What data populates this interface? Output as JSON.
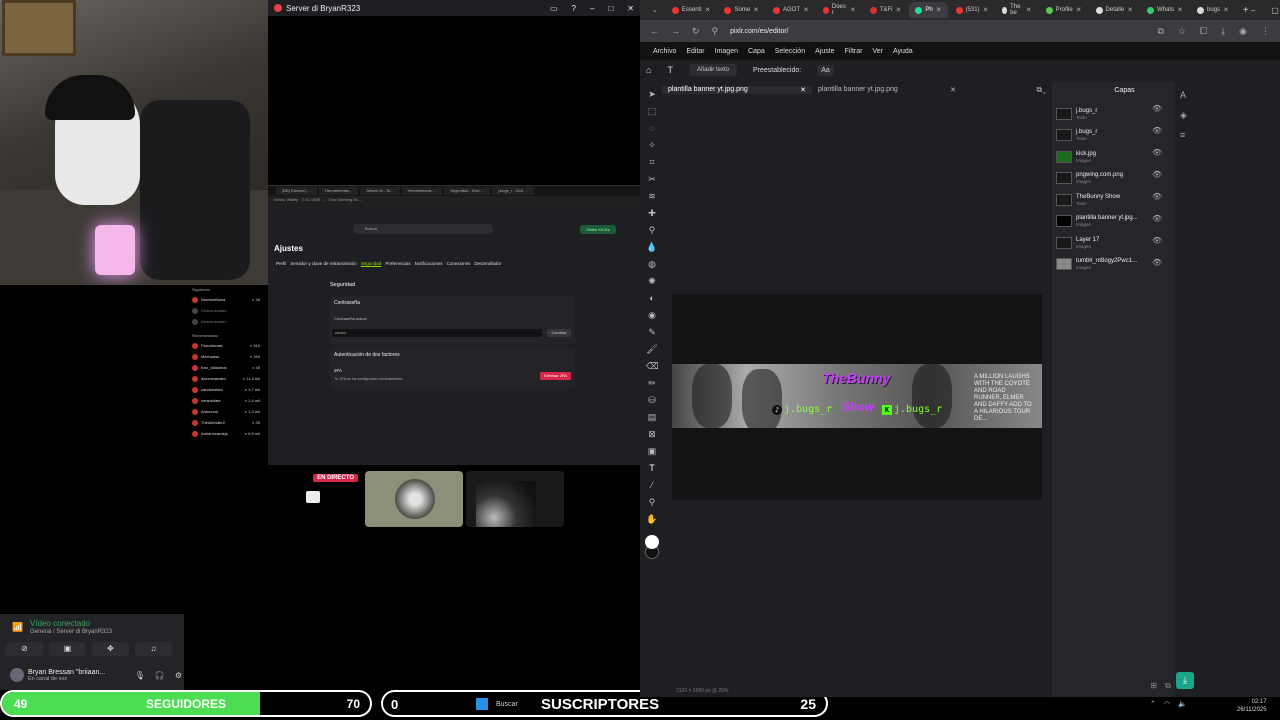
{
  "discord": {
    "window_title": "Server di BryanR323",
    "shared_screen": {
      "tabs": [
        "[DB] Discord | ...",
        "Herramientas...",
        "Añadir IA - Te...",
        "Herramientas ...",
        "Seguridad - Kick ...",
        "j.bugs_r - Kick ..."
      ],
      "bookmarks": "Kiroku Vitality · 7 XL GWE ... · Ono VabVerg 66 ...",
      "search_placeholder": "Buscar",
      "obtain_label": "Obtén KICKs",
      "heading": "Ajustes",
      "settings_tabs": [
        "Perfil",
        "Servidor y clave de retransmisión",
        "Seguridad",
        "Preferencias",
        "Notificaciones",
        "Conexiones",
        "Desarrollador"
      ],
      "active_tab": "Seguridad",
      "section_title": "Seguridad",
      "password_title": "Contraseña",
      "password_label": "Contraseña actual",
      "password_value": "••••••••",
      "change_label": "Cambiar",
      "twofa_title": "Autenticación de dos factores",
      "twofa_label": "2FA",
      "twofa_desc": "Tu 2FA se ha configurado correctamente",
      "delete_2fa_label": "Eliminar 2FA"
    },
    "following": {
      "heading": "Siguiendo",
      "items": [
        {
          "name": "NombreBuiza",
          "count": "36"
        },
        {
          "name": "Desconectado",
          "count": ""
        },
        {
          "name": "Desconectado",
          "count": ""
        }
      ]
    },
    "recommended": {
      "heading": "Recomendado",
      "items": [
        {
          "name": "PanoAnnasi",
          "count": "515"
        },
        {
          "name": "Mechaass",
          "count": "254"
        },
        {
          "name": "fran_villalobos",
          "count": "48"
        },
        {
          "name": "daxxninanalm",
          "count": "11,3 mil"
        },
        {
          "name": "zandoeskira",
          "count": "3,7 mil"
        },
        {
          "name": "cmaninfate",
          "count": "1,4 mil"
        },
        {
          "name": "Antuunus",
          "count": "1,3 mil"
        },
        {
          "name": "TheAllenderZ",
          "count": "35"
        },
        {
          "name": "Adrianocardejo",
          "count": "6,9 mil"
        }
      ]
    },
    "live_badge": "EN DIRECTO",
    "voice": {
      "status": "Vídeo conectado",
      "channel": "General / Server di BryanR323",
      "user_name": "Bryan Bressan \"briiaan...",
      "user_status": "En canal de voz"
    }
  },
  "overlays": {
    "followers": {
      "current": "49",
      "label": "SEGUIDORES",
      "goal": "70",
      "progress": 0.7
    },
    "subscribers": {
      "current": "0",
      "label": "SUSCRIPTORES",
      "goal": "25"
    }
  },
  "taskbar": {
    "search_label": "Buscar",
    "time": "02:17",
    "date": "26/11/2025"
  },
  "browser": {
    "tabs": [
      {
        "label": "Essenti",
        "color": "#e33"
      },
      {
        "label": "Some",
        "color": "#e33"
      },
      {
        "label": "AGOT",
        "color": "#e33"
      },
      {
        "label": "Does r",
        "color": "#e33"
      },
      {
        "label": "T&Fi",
        "color": "#c33"
      },
      {
        "label": "Ph",
        "color": "#2d9"
      },
      {
        "label": "(531)",
        "color": "#e33"
      },
      {
        "label": "The be",
        "color": "#ddd"
      },
      {
        "label": "Profile",
        "color": "#5c5"
      },
      {
        "label": "Detalle",
        "color": "#ddd"
      },
      {
        "label": "Whats",
        "color": "#3c6"
      },
      {
        "label": "bugs",
        "color": "#ddd"
      }
    ],
    "url": "pixlr.com/es/editor/"
  },
  "pixlr": {
    "menu": [
      "Archivo",
      "Editar",
      "Imagen",
      "Capa",
      "Selección",
      "Ajuste",
      "Filtrar",
      "Ver",
      "Ayuda"
    ],
    "add_text_label": "Añadir texto",
    "preset_label": "Preestablecido:",
    "preset_value": "Aa",
    "doc_tabs": [
      "plantilla banner yt.jpg.png",
      "plantilla banner yt.jpg.png"
    ],
    "banner": {
      "title_top": "TheBunny",
      "title_bottom": "Show",
      "tiktok": "j.bugs_r",
      "kick": "j.bugs_r",
      "tagline": "A MILLION LAUGHS WITH THE COYOTE AND ROAD RUNNER, ELMER AND DAFFY ADD TO A HILARIOUS TOUR DE..."
    },
    "layers_title": "Capas",
    "layers": [
      {
        "name": "j.bugs_r",
        "type": "Texto"
      },
      {
        "name": "j.bugs_r",
        "type": "Texto"
      },
      {
        "name": "kick.jpg",
        "type": "Imagen"
      },
      {
        "name": "pngwing.com.png",
        "type": "Imagen"
      },
      {
        "name": "TheBunny Show",
        "type": "Texto"
      },
      {
        "name": "plantilla banner yt.jpg...",
        "type": "Imagen"
      },
      {
        "name": "Layer 17",
        "type": "Imagen"
      },
      {
        "name": "tumblr_nt8ogy2Pwc1...",
        "type": "Imagen"
      }
    ],
    "status": "3120 × 1560 px @ 25%"
  }
}
